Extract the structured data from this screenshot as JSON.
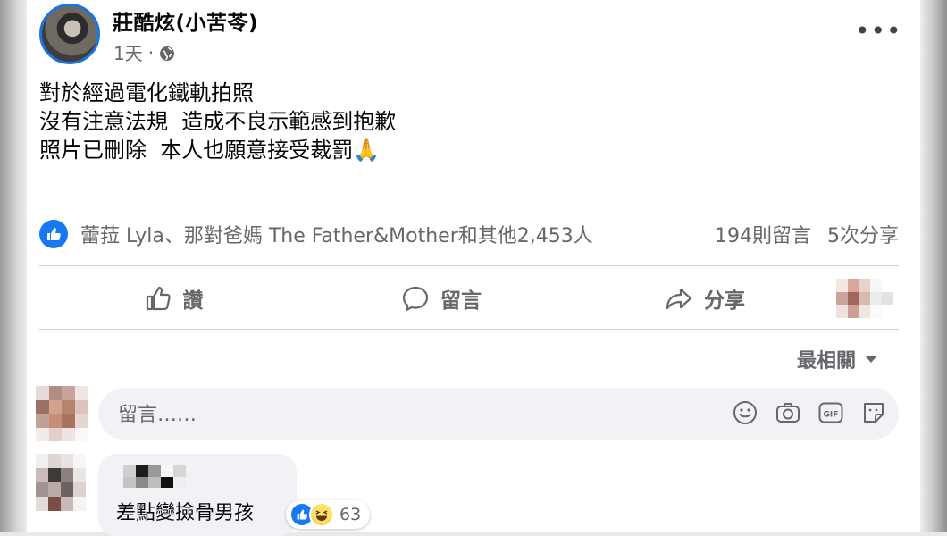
{
  "post": {
    "author": "莊酷炫(小苦苓)",
    "time": "1天",
    "separator": "·",
    "lines": [
      "對於經過電化鐵軌拍照",
      "沒有注意法規  造成不良示範感到抱歉",
      "照片已刪除  本人也願意接受裁罰🙏"
    ]
  },
  "reactions": {
    "summary": "蕾菈 Lyla、那對爸媽 The Father&Mother和其他2,453人",
    "comments": "194則留言",
    "shares": "5次分享"
  },
  "actions": {
    "like": "讚",
    "comment": "留言",
    "share": "分享"
  },
  "sort_label": "最相關",
  "comment_box": {
    "placeholder": "留言……"
  },
  "reply": {
    "text": "差點變撿骨男孩",
    "reaction_count": "63"
  },
  "colors": {
    "accent": "#1877f2",
    "secondary_text": "#65676b",
    "bubble": "#f0f2f5"
  },
  "icons": {
    "privacy": "globe-icon",
    "more": "more-options-icon",
    "like": "thumbs-up-icon",
    "comment": "comment-icon",
    "share": "share-icon",
    "emoji": "emoji-icon",
    "camera": "camera-icon",
    "gif": "gif-icon",
    "sticker": "sticker-icon"
  }
}
